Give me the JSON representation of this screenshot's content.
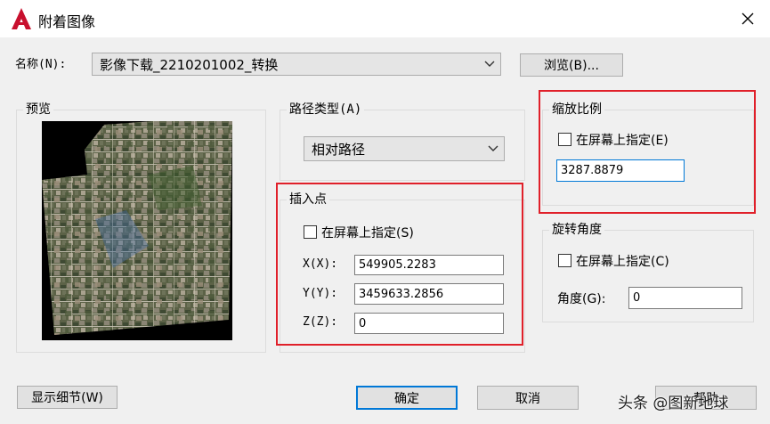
{
  "window": {
    "title": "附着图像"
  },
  "name_row": {
    "label": "名称(N):",
    "value": "影像下载_2210201002_转换",
    "browse_label": "浏览(B)..."
  },
  "preview": {
    "legend": "预览"
  },
  "path_type": {
    "legend": "路径类型(A)",
    "value": "相对路径"
  },
  "insertion_point": {
    "legend": "插入点",
    "specify_label": "在屏幕上指定(S)",
    "specify_checked": false,
    "x_label": "X(X):",
    "x_value": "549905.2283",
    "y_label": "Y(Y):",
    "y_value": "3459633.2856",
    "z_label": "Z(Z):",
    "z_value": "0"
  },
  "scale": {
    "legend": "缩放比例",
    "specify_label": "在屏幕上指定(E)",
    "specify_checked": false,
    "value": "3287.8879"
  },
  "rotation": {
    "legend": "旋转角度",
    "specify_label": "在屏幕上指定(C)",
    "specify_checked": false,
    "angle_label": "角度(G):",
    "angle_value": "0"
  },
  "buttons": {
    "details_label": "显示细节(W)",
    "ok_label": "确定",
    "cancel_label": "取消",
    "help_label": "帮助"
  },
  "watermark": {
    "text": "头条 @图新地球"
  },
  "colors": {
    "highlight_red": "#e0202a",
    "accent_blue": "#0078d7",
    "logo_red": "#c8102e"
  }
}
